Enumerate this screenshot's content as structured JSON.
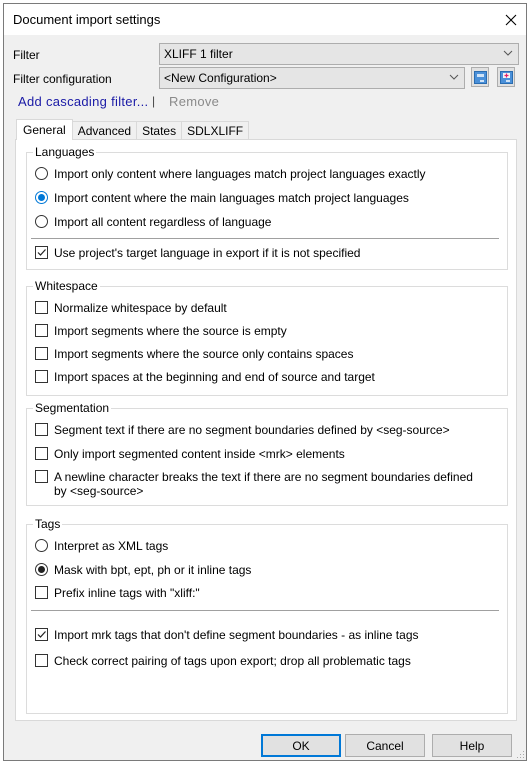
{
  "window": {
    "title": "Document import settings"
  },
  "filter": {
    "label": "Filter",
    "value": "XLIFF 1 filter"
  },
  "filter_configuration": {
    "label": "Filter configuration",
    "value": "<New Configuration>"
  },
  "links": {
    "add_cascading": "Add cascading filter...",
    "separator": "|",
    "remove": "Remove"
  },
  "tabs": [
    {
      "label": "General",
      "active": true
    },
    {
      "label": "Advanced",
      "active": false
    },
    {
      "label": "States",
      "active": false
    },
    {
      "label": "SDLXLIFF",
      "active": false
    }
  ],
  "groups": {
    "languages": {
      "title": "Languages",
      "options": [
        {
          "type": "radio",
          "label": "Import only content where languages match project languages exactly",
          "checked": false
        },
        {
          "type": "radio",
          "label": "Import content where the main languages match project languages",
          "checked": true
        },
        {
          "type": "radio",
          "label": "Import all content regardless of language",
          "checked": false
        },
        {
          "type": "checkbox",
          "label": "Use project's target language in export if it is not specified",
          "checked": true
        }
      ]
    },
    "whitespace": {
      "title": "Whitespace",
      "options": [
        {
          "type": "checkbox",
          "label": "Normalize whitespace by default",
          "checked": false
        },
        {
          "type": "checkbox",
          "label": "Import segments where the source is empty",
          "checked": false
        },
        {
          "type": "checkbox",
          "label": "Import segments where the source only contains spaces",
          "checked": false
        },
        {
          "type": "checkbox",
          "label": "Import spaces at the beginning and end of source and target",
          "checked": false
        }
      ]
    },
    "segmentation": {
      "title": "Segmentation",
      "options": [
        {
          "type": "checkbox",
          "label": "Segment text if there are no segment boundaries defined by <seg-source>",
          "checked": false
        },
        {
          "type": "checkbox",
          "label": "Only import segmented content inside <mrk> elements",
          "checked": false
        },
        {
          "type": "checkbox",
          "label_line1": "A newline character breaks the text if there are no segment boundaries defined",
          "label_line2": "by <seg-source>",
          "checked": false
        }
      ]
    },
    "tags": {
      "title": "Tags",
      "options": [
        {
          "type": "radio",
          "label": "Interpret as XML tags",
          "checked": false
        },
        {
          "type": "radio",
          "label": "Mask with bpt, ept, ph or it inline tags",
          "checked": true
        },
        {
          "type": "checkbox",
          "label": "Prefix inline tags with \"xliff:\"",
          "checked": false
        },
        {
          "type": "checkbox",
          "label": "Import mrk tags that don't define segment boundaries - as inline tags",
          "checked": true
        },
        {
          "type": "checkbox",
          "label": "Check correct pairing of tags upon export; drop all problematic tags",
          "checked": false
        }
      ]
    }
  },
  "buttons": {
    "ok": "OK",
    "cancel": "Cancel",
    "help": "Help"
  },
  "colors": {
    "accent": "#0078d7",
    "link": "#1a1aa6"
  }
}
